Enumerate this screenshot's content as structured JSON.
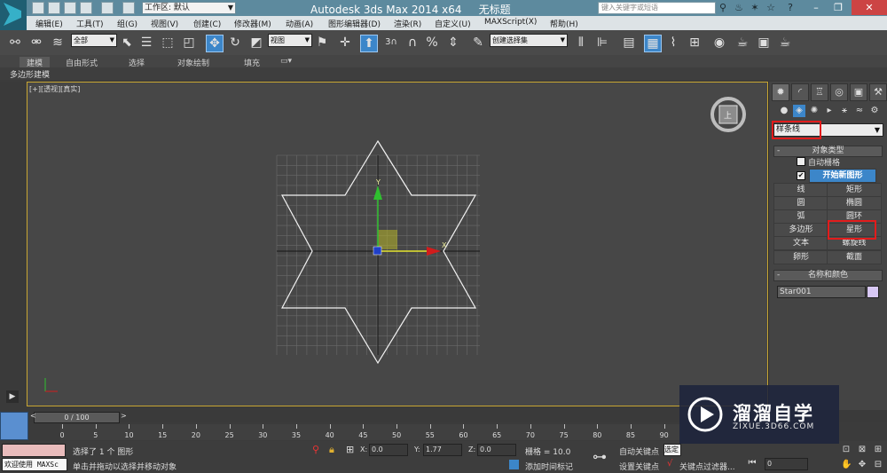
{
  "titlebar": {
    "app_title": "Autodesk 3ds Max  2014 x64",
    "doc_title": "无标题",
    "workspace": "工作区: 默认",
    "search_placeholder": "键入关键字或短语"
  },
  "menu": [
    "编辑(E)",
    "工具(T)",
    "组(G)",
    "视图(V)",
    "创建(C)",
    "修改器(M)",
    "动画(A)",
    "图形编辑器(D)",
    "渲染(R)",
    "自定义(U)",
    "MAXScript(X)",
    "帮助(H)"
  ],
  "toolbar": {
    "selection_filter": "全部",
    "ref_coord": "视图",
    "snap_angle": "3",
    "named_selection": "创建选择集"
  },
  "ribbon": {
    "tabs": [
      "建模",
      "自由形式",
      "选择",
      "对象绘制",
      "填充"
    ],
    "sub_label": "多边形建模"
  },
  "viewport": {
    "label": "[+][透视][真实]",
    "axis_x": "X",
    "axis_y": "Y",
    "cube_face": "上"
  },
  "command_panel": {
    "category": "样条线",
    "object_type_title": "对象类型",
    "autogrid": "自动栅格",
    "start_new_shape": "开始新图形",
    "buttons": [
      "线",
      "矩形",
      "圆",
      "椭圆",
      "弧",
      "圆环",
      "多边形",
      "星形",
      "文本",
      "螺旋线",
      "卵形",
      "截面"
    ],
    "name_color_title": "名称和颜色",
    "object_name": "Star001",
    "object_color": "#d8c8f5",
    "highlight_color": "#e21c1c"
  },
  "timeline": {
    "frame_slider": "0 / 100",
    "ticks": [
      "0",
      "5",
      "10",
      "15",
      "20",
      "25",
      "30",
      "35",
      "40",
      "45",
      "50",
      "55",
      "60",
      "65",
      "70",
      "75",
      "80",
      "85",
      "90"
    ]
  },
  "status": {
    "welcome": "欢迎使用 MAXSc",
    "selection": "选择了 1 个 图形",
    "prompt": "单击并拖动以选择并移动对象",
    "x_label": "X:",
    "x_value": "0.0",
    "y_label": "Y:",
    "y_value": "1.77",
    "z_label": "Z:",
    "z_value": "0.0",
    "grid": "栅格 = 10.0",
    "add_time_tag": "添加时间标记",
    "auto_key": "自动关键点",
    "set_key": "设置关键点",
    "key_filter": "关键点过滤器...",
    "sel_dd": "选定",
    "frame": "0"
  },
  "watermark": {
    "title": "溜溜自学",
    "url": "ZIXUE.3D66.COM"
  }
}
